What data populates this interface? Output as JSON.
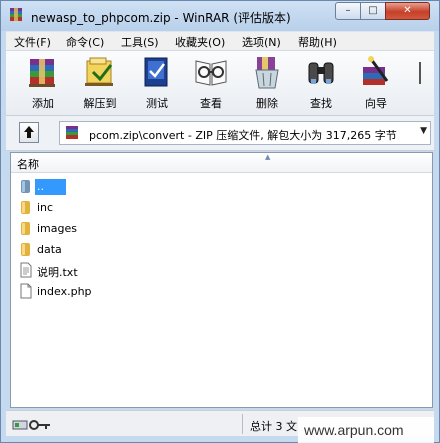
{
  "window": {
    "title": "newasp_to_phpcom.zip - WinRAR (评估版本)",
    "controls": {
      "minimize": "–",
      "maximize": "□",
      "close": "✕"
    }
  },
  "menu": [
    "文件(F)",
    "命令(C)",
    "工具(S)",
    "收藏夹(O)",
    "选项(N)",
    "帮助(H)"
  ],
  "toolbar": {
    "buttons": [
      {
        "label": "添加",
        "icon": "add-archive-icon"
      },
      {
        "label": "解压到",
        "icon": "extract-to-icon"
      },
      {
        "label": "测试",
        "icon": "test-icon"
      },
      {
        "label": "查看",
        "icon": "view-icon"
      },
      {
        "label": "删除",
        "icon": "delete-icon"
      },
      {
        "label": "查找",
        "icon": "find-icon"
      },
      {
        "label": "向导",
        "icon": "wizard-icon"
      }
    ]
  },
  "address": {
    "text": "pcom.zip\\convert - ZIP 压缩文件, 解包大小为 317,265 字节"
  },
  "filelist": {
    "column_name": "名称",
    "rows": [
      {
        "name": "..",
        "type": "parent",
        "selected": true
      },
      {
        "name": "inc",
        "type": "folder",
        "selected": false
      },
      {
        "name": "images",
        "type": "folder",
        "selected": false
      },
      {
        "name": "data",
        "type": "folder",
        "selected": false
      },
      {
        "name": "说明.txt",
        "type": "file",
        "selected": false
      },
      {
        "name": "index.php",
        "type": "file",
        "selected": false
      }
    ]
  },
  "status": {
    "text": "总计 3 文"
  },
  "watermark": "www.arpun.com",
  "colors": {
    "selection": "#3399ff",
    "accent": "#c5d9ef"
  }
}
